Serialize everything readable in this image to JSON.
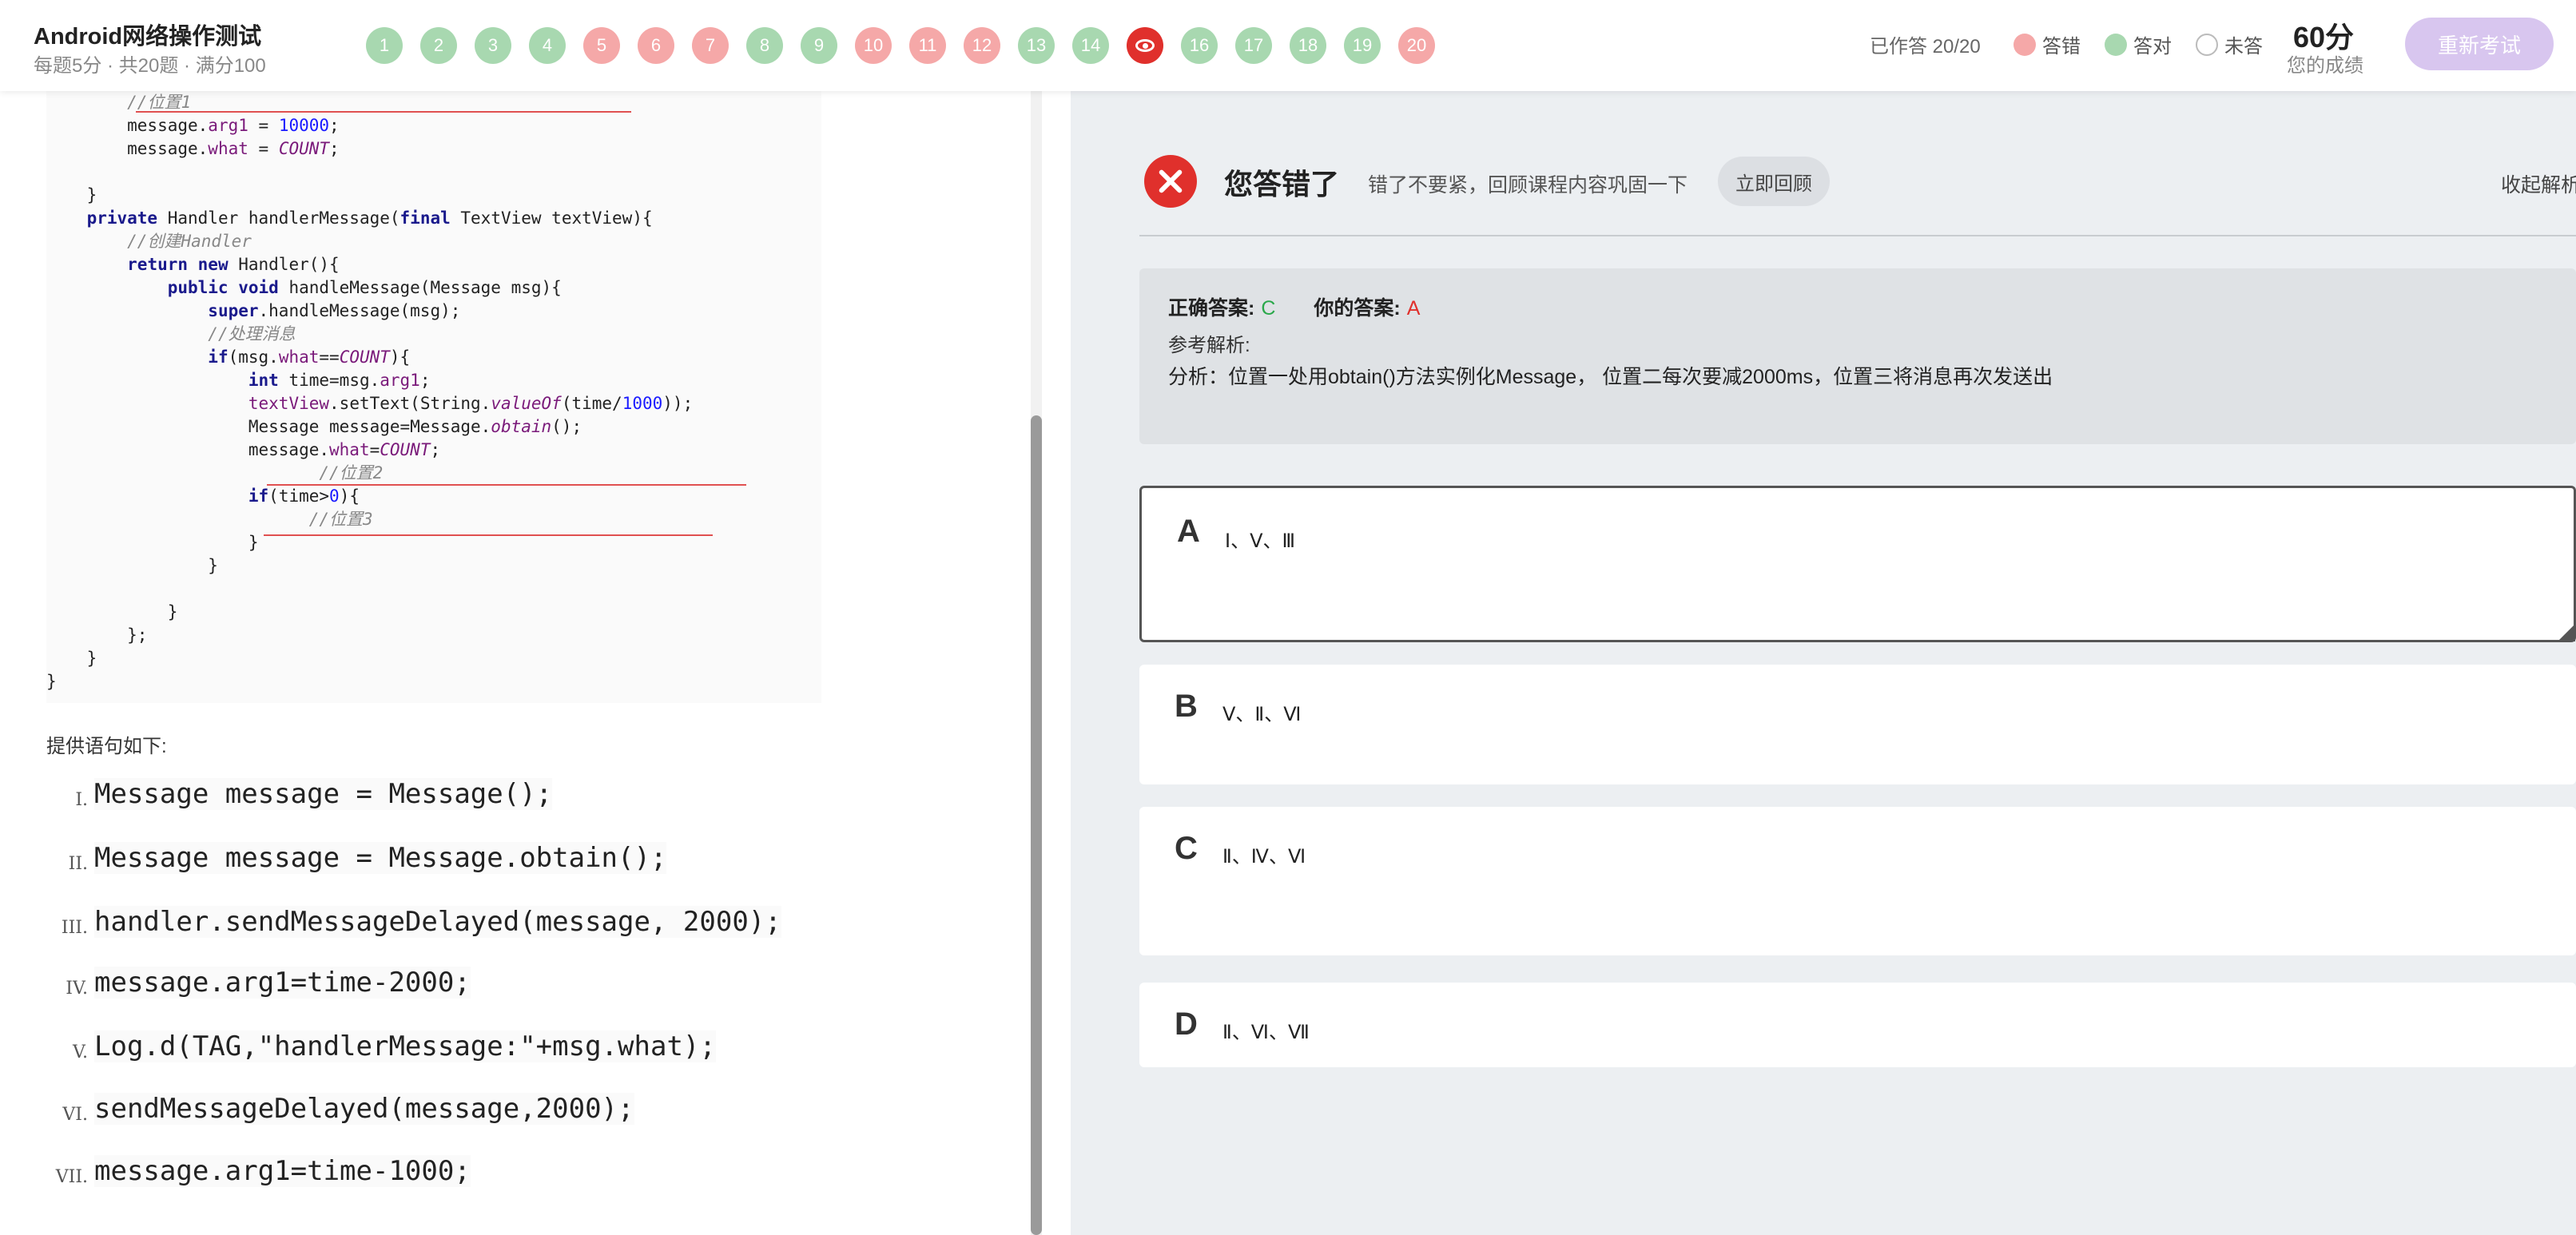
{
  "header": {
    "title": "Android网络操作测试",
    "meta": "每题5分 · 共20题 · 满分100",
    "questions": [
      {
        "n": "1",
        "state": "correct"
      },
      {
        "n": "2",
        "state": "correct"
      },
      {
        "n": "3",
        "state": "correct"
      },
      {
        "n": "4",
        "state": "correct"
      },
      {
        "n": "5",
        "state": "wrong"
      },
      {
        "n": "6",
        "state": "wrong"
      },
      {
        "n": "7",
        "state": "wrong"
      },
      {
        "n": "8",
        "state": "correct"
      },
      {
        "n": "9",
        "state": "correct"
      },
      {
        "n": "10",
        "state": "wrong"
      },
      {
        "n": "11",
        "state": "wrong"
      },
      {
        "n": "12",
        "state": "wrong"
      },
      {
        "n": "13",
        "state": "correct"
      },
      {
        "n": "14",
        "state": "correct"
      },
      {
        "n": "15",
        "state": "current"
      },
      {
        "n": "16",
        "state": "correct"
      },
      {
        "n": "17",
        "state": "correct"
      },
      {
        "n": "18",
        "state": "correct"
      },
      {
        "n": "19",
        "state": "correct"
      },
      {
        "n": "20",
        "state": "wrong"
      }
    ],
    "answered": "已作答 20/20",
    "legend_wrong": "答错",
    "legend_correct": "答对",
    "legend_none": "未答",
    "score": "60分",
    "score_label": "您的成绩",
    "retry": "重新考试",
    "colors": {
      "correct": "#a8d8b0",
      "wrong": "#f5a8a8",
      "current": "#e0302c",
      "accent": "#d8c6ef"
    }
  },
  "left": {
    "provide_label": "提供语句如下:",
    "statements": [
      {
        "roman": "I.",
        "code": "Message message = Message();"
      },
      {
        "roman": "II.",
        "code": "Message message = Message.obtain();"
      },
      {
        "roman": "III.",
        "code": "handler.sendMessageDelayed(message, 2000);"
      },
      {
        "roman": "IV.",
        "code": "message.arg1=time-2000;"
      },
      {
        "roman": "V.",
        "code": "Log.d(TAG,\"handlerMessage:\"+msg.what);"
      },
      {
        "roman": "VI.",
        "code": "sendMessageDelayed(message,2000);"
      },
      {
        "roman": "VII.",
        "code": "message.arg1=time-1000;"
      }
    ]
  },
  "feedback": {
    "title": "您答错了",
    "subtitle": "错了不要紧，回顾课程内容巩固一下",
    "review": "立即回顾",
    "collapse": "收起解析",
    "correct_label": "正确答案:",
    "correct_value": "C",
    "your_label": "你的答案:",
    "your_value": "A",
    "analysis_label": "参考解析:",
    "analysis_text": "分析：位置一处用obtain()方法实例化Message， 位置二每次要减2000ms，位置三将消息再次发送出"
  },
  "options": [
    {
      "letter": "A",
      "text": "Ⅰ、Ⅴ、Ⅲ",
      "selected": true
    },
    {
      "letter": "B",
      "text": "Ⅴ、Ⅱ、Ⅵ",
      "selected": false
    },
    {
      "letter": "C",
      "text": "Ⅱ、Ⅳ、Ⅵ",
      "selected": false
    },
    {
      "letter": "D",
      "text": "Ⅱ、Ⅵ、Ⅶ",
      "selected": false
    }
  ]
}
